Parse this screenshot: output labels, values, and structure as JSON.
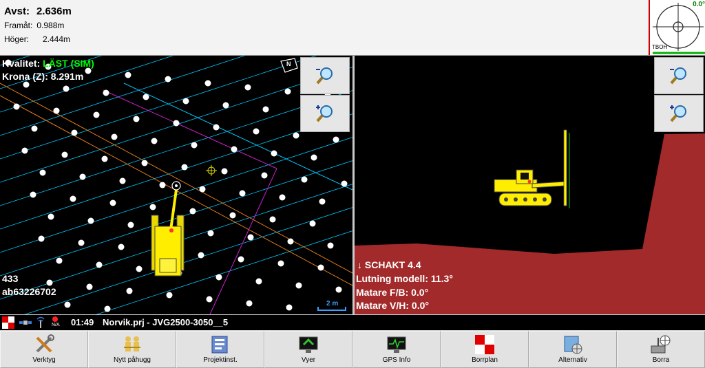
{
  "readout": {
    "avst_label": "Avst:",
    "avst_value": "2.636m",
    "framat_label": "Framåt:",
    "framat_value": "0.988m",
    "hoger_label": "Höger:",
    "hoger_value": "2.444m"
  },
  "compass": {
    "angle": "0.0°",
    "label": "TBOH"
  },
  "plan_view": {
    "kvalitet_label": "Kvalitet:",
    "kvalitet_value": "LÄST (SIM)",
    "krona_label": "Krona (Z):",
    "krona_value": "8.291m",
    "point_number": "433",
    "point_id": "ab63226702",
    "scale_label": "2 m",
    "north_marker": "N"
  },
  "profile_view": {
    "schakt": "↓ SCHAKT 4.4",
    "lutning": "Lutning modell: 11.3°",
    "matare_fb": "Matare F/B: 0.0°",
    "matare_vh": "Matare V/H: 0.0°"
  },
  "statusbar": {
    "gps_na": "N/A",
    "time": "01:49",
    "project": "Norvik.prj - JVG2500-3050__5"
  },
  "toolbar": [
    {
      "label": "Verktyg",
      "icon": "tools-icon"
    },
    {
      "label": "Nytt påhugg",
      "icon": "new-hole-icon"
    },
    {
      "label": "Projektinst.",
      "icon": "project-settings-icon"
    },
    {
      "label": "Vyer",
      "icon": "views-icon"
    },
    {
      "label": "GPS Info",
      "icon": "gps-info-icon"
    },
    {
      "label": "Borrplan",
      "icon": "drill-plan-icon"
    },
    {
      "label": "Alternativ",
      "icon": "alternatives-icon"
    },
    {
      "label": "Borra",
      "icon": "drill-icon"
    }
  ],
  "colors": {
    "quality_green": "#00ff00",
    "ground_red": "#a32a2a",
    "machine_yellow": "#ffee00",
    "design_cyan": "#00c8ff",
    "boundary_orange": "#e07a1a",
    "boundary_magenta": "#d020d0"
  }
}
